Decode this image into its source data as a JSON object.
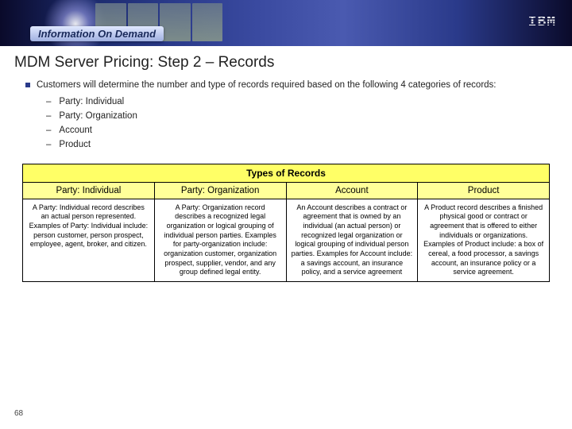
{
  "banner": {
    "tagline": "Information On Demand",
    "logo": "IBM"
  },
  "title": "MDM Server Pricing: Step 2 – Records",
  "intro": "Customers will determine the number and type of records required based on the following 4 categories of records:",
  "categories": [
    "Party: Individual",
    "Party: Organization",
    "Account",
    "Product"
  ],
  "table": {
    "header": "Types of Records",
    "cols": [
      "Party: Individual",
      "Party: Organization",
      "Account",
      "Product"
    ],
    "descs": [
      "A Party: Individual record describes an actual person represented. Examples of Party: Individual include: person customer, person prospect, employee, agent, broker, and citizen.",
      "A Party: Organization record describes a recognized legal organization or logical grouping of individual person parties. Examples for party-organization include: organization customer, organization prospect, supplier, vendor, and any group defined legal entity.",
      "An Account describes a contract or agreement that is owned by an individual (an actual person) or recognized legal organization or logical grouping of individual person parties. Examples for Account include: a savings account, an insurance policy, and a service agreement",
      "A Product record describes a finished physical good or contract or agreement that is offered to either individuals or organizations. Examples of Product include: a box of cereal, a food processor, a savings account, an insurance policy or a service agreement."
    ]
  },
  "page": "68"
}
